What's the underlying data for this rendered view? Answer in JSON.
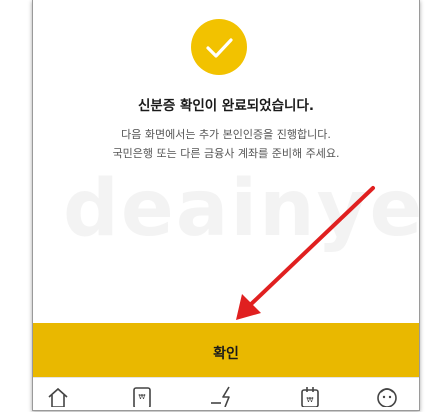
{
  "success": {
    "title": "신분증 확인이 완료되었습니다.",
    "description_line1": "다음 화면에서는 추가 본인인증을 진행합니다.",
    "description_line2": "국민은행 또는 다른 금융사 계좌를 준비해 주세요."
  },
  "watermark": "deainyer",
  "confirm_button": {
    "label": "확인"
  },
  "tabbar": {
    "items": [
      {
        "icon": "home-icon"
      },
      {
        "icon": "card-icon"
      },
      {
        "icon": "transfer-icon"
      },
      {
        "icon": "calendar-icon"
      },
      {
        "icon": "profile-icon"
      }
    ]
  },
  "colors": {
    "accent": "#e9b800",
    "check": "#f2c200",
    "arrow": "#e02020"
  }
}
